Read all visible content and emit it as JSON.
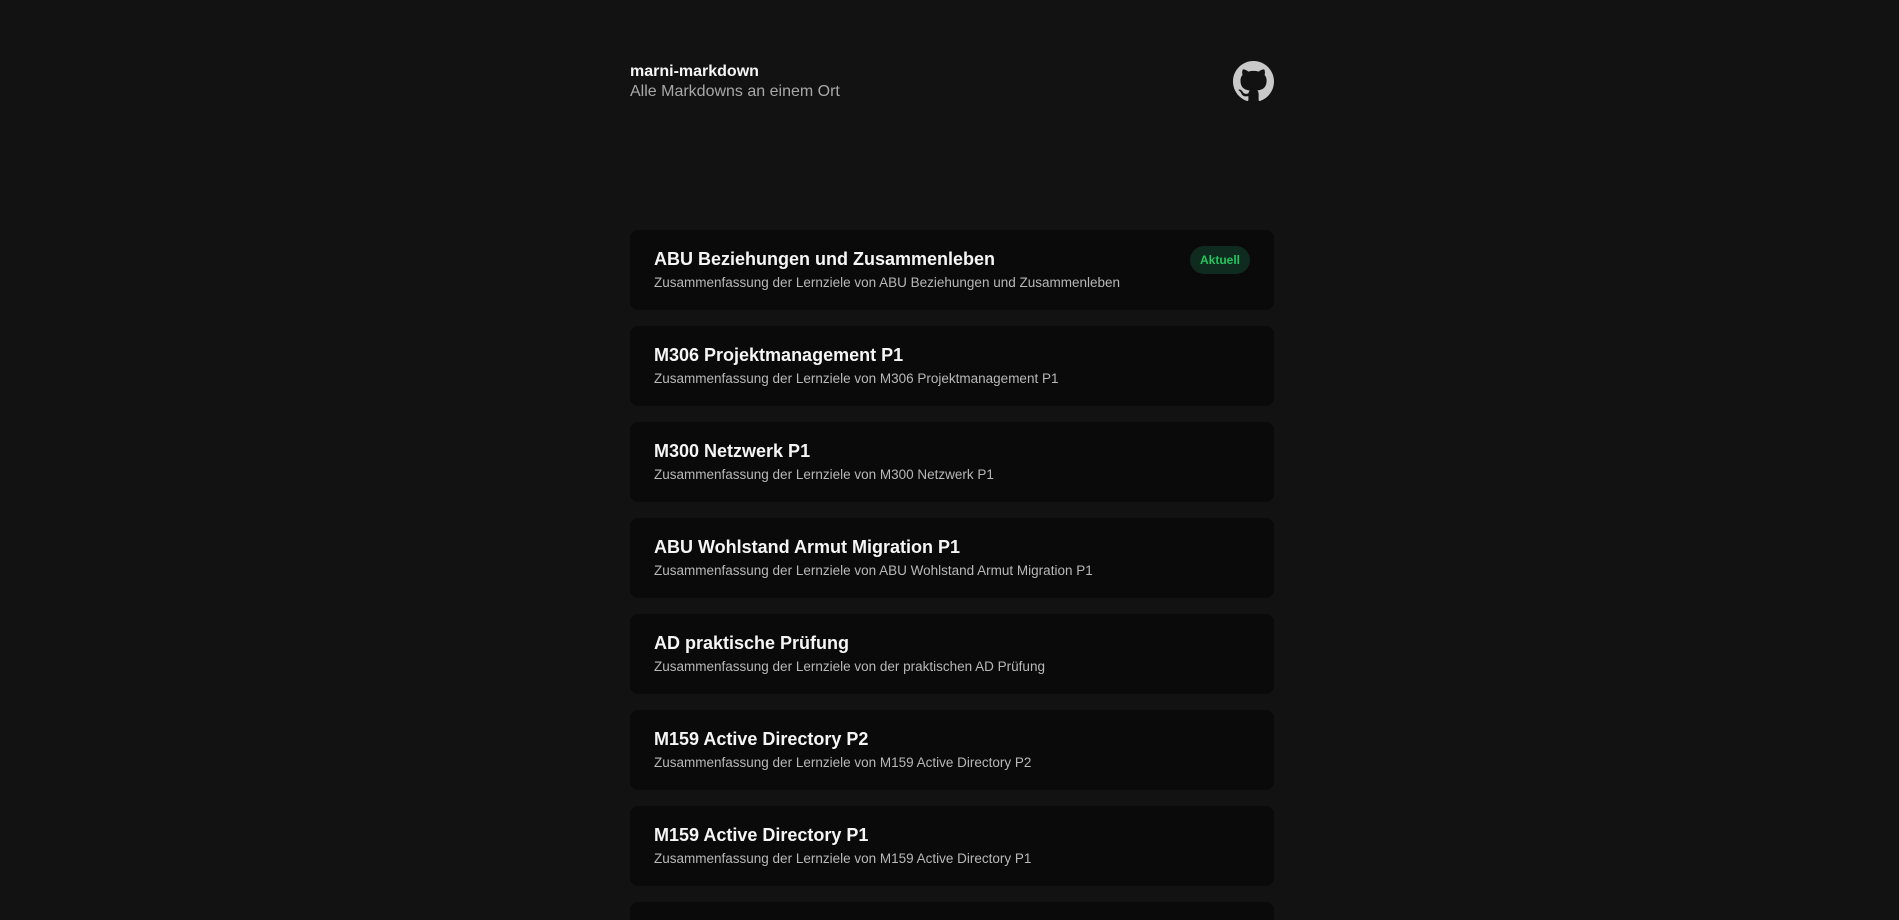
{
  "header": {
    "title": "marni-markdown",
    "subtitle": "Alle Markdowns an einem Ort",
    "github_icon": "github-icon"
  },
  "colors": {
    "background": "#121212",
    "card": "#0a0a0a",
    "badge_text": "#22c55e",
    "badge_bg": "#0f2a1f"
  },
  "items": [
    {
      "title": "ABU Beziehungen und Zusammenleben",
      "description": "Zusammenfassung der Lernziele von ABU Beziehungen und Zusammenleben",
      "badge": "Aktuell"
    },
    {
      "title": "M306 Projektmanagement P1",
      "description": "Zusammenfassung der Lernziele von M306 Projektmanagement P1"
    },
    {
      "title": "M300 Netzwerk P1",
      "description": "Zusammenfassung der Lernziele von M300 Netzwerk P1"
    },
    {
      "title": "ABU Wohlstand Armut Migration P1",
      "description": "Zusammenfassung der Lernziele von ABU Wohlstand Armut Migration P1"
    },
    {
      "title": "AD praktische Prüfung",
      "description": "Zusammenfassung der Lernziele von der praktischen AD Prüfung"
    },
    {
      "title": "M159 Active Directory P2",
      "description": "Zusammenfassung der Lernziele von M159 Active Directory P2"
    },
    {
      "title": "M159 Active Directory P1",
      "description": "Zusammenfassung der Lernziele von M159 Active Directory P1"
    }
  ]
}
